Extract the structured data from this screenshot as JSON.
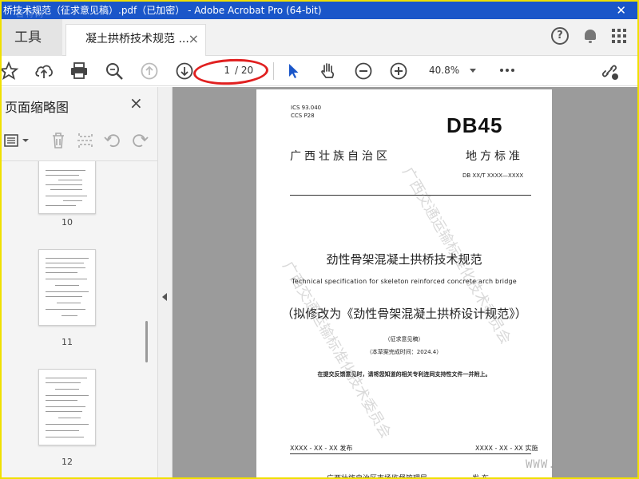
{
  "window": {
    "title": "桥技术规范（征求意见稿）.pdf（已加密） - Adobe Acrobat Pro (64-bit)",
    "watermark_corner": "百特网",
    "accent_color": "#1a56c9"
  },
  "tabs": {
    "tools_label": "工具",
    "doc_label": "凝土拱桥技术规范 ...",
    "close_glyph": "×"
  },
  "top_icons": [
    "help-icon",
    "bell-icon",
    "apps-grid-icon"
  ],
  "toolbar": {
    "current_page": "1",
    "total_pages": "/ 20",
    "zoom": "40.8%",
    "highlight_color": "#e02020"
  },
  "sidebar": {
    "title": "页面缩略图",
    "close_glyph": "×",
    "thumbnails": [
      {
        "label": "10"
      },
      {
        "label": "11"
      },
      {
        "label": "12"
      }
    ]
  },
  "document": {
    "ics": "ICS  93.040",
    "ccs": "CCS P28",
    "code": "DB45",
    "region": "广西壮族自治区",
    "std_type": "地方标准",
    "std_no": "DB XX/T XXXX—XXXX",
    "title_cn": "劲性骨架混凝土拱桥技术规范",
    "title_en": "Technical specification for skeleton reinforced concrete arch bridge",
    "rename_note": "（拟修改为《劲性骨架混凝土拱桥设计规范》）",
    "draft": "（征求意见稿）",
    "completed": "（本草案完成时间：2024.4）",
    "notice": "在提交反馈意见时，请将您知道的相关专利连同支持性文件一并附上。",
    "publish_date": "XXXX - XX - XX 发布",
    "implement_date": "XXXX - XX - XX 实施",
    "issuer": "广西壮族自治区市场监督管理局",
    "issue_word": "发 布",
    "watermark_text": "广西交通运输标准化技术委员会"
  },
  "overlay": {
    "www": "WWW."
  }
}
